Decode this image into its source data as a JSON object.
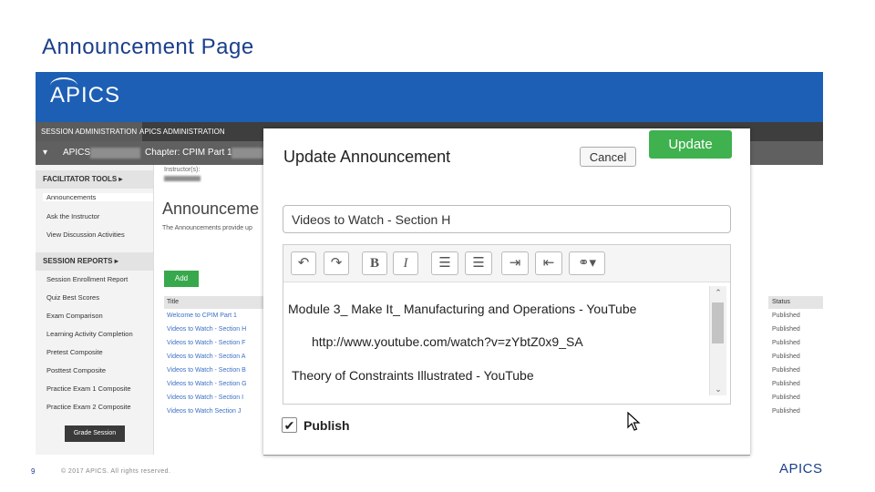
{
  "slide": {
    "title": "Announcement Page",
    "page_number": "9",
    "copyright": "© 2017 APICS. All rights reserved.",
    "footer_logo": "APICS"
  },
  "app": {
    "logo": "APICS",
    "nav_tabs": [
      "SESSION ADMINISTRATION",
      "APICS ADMINISTRATION"
    ],
    "session_bar": {
      "prefix": "APICS",
      "chapter": "Chapter: CPIM Part 1"
    },
    "sidebar": {
      "facilitator_tools": "FACILITATOR TOOLS",
      "tools_items": [
        "Announcements",
        "Ask the Instructor",
        "View Discussion Activities"
      ],
      "session_reports": "SESSION REPORTS",
      "report_items": [
        "Session Enrollment Report",
        "Quiz Best Scores",
        "Exam Comparison",
        "Learning Activity Completion",
        "Pretest Composite",
        "Posttest Composite",
        "Practice Exam 1 Composite",
        "Practice Exam 2 Composite"
      ],
      "grade_button": "Grade Session"
    },
    "content": {
      "instructor_label": "Instructor(s):",
      "page_title": "Announceme",
      "description": "The Announcements provide up",
      "add_button": "Add",
      "table_header_title": "Title",
      "table_header_status": "Status",
      "rows": [
        "Welcome to CPIM Part 1",
        "Videos to Watch - Section H",
        "Videos to Watch - Section F",
        "Videos to Watch - Section A",
        "Videos to Watch - Section B",
        "Videos to Watch - Section G",
        "Videos to Watch - Section I",
        "Videos to Watch Section J"
      ],
      "statuses": [
        "Published",
        "Published",
        "Published",
        "Published",
        "Published",
        "Published",
        "Published",
        "Published"
      ]
    }
  },
  "modal": {
    "title": "Update Announcement",
    "cancel_label": "Cancel",
    "update_label": "Update",
    "title_value": "Videos to Watch - Section H",
    "toolbar": {
      "undo": "↶",
      "redo": "↷",
      "bold": "B",
      "italic": "I",
      "bullet_list": "☰",
      "numbered_list": "☰",
      "indent": "⇥",
      "outdent": "⇤",
      "link": "⚭▾"
    },
    "editor_lines": [
      "Module 3_ Make It_ Manufacturing and Operations - YouTube",
      "http://www.youtube.com/watch?v=zYbtZ0x9_SA",
      "Theory of Constraints Illustrated - YouTube"
    ],
    "publish_label": "Publish",
    "publish_checked": "✔"
  },
  "colors": {
    "brand_blue": "#1d5fb4",
    "green": "#3fb14e",
    "title_blue": "#1b3f8b"
  }
}
